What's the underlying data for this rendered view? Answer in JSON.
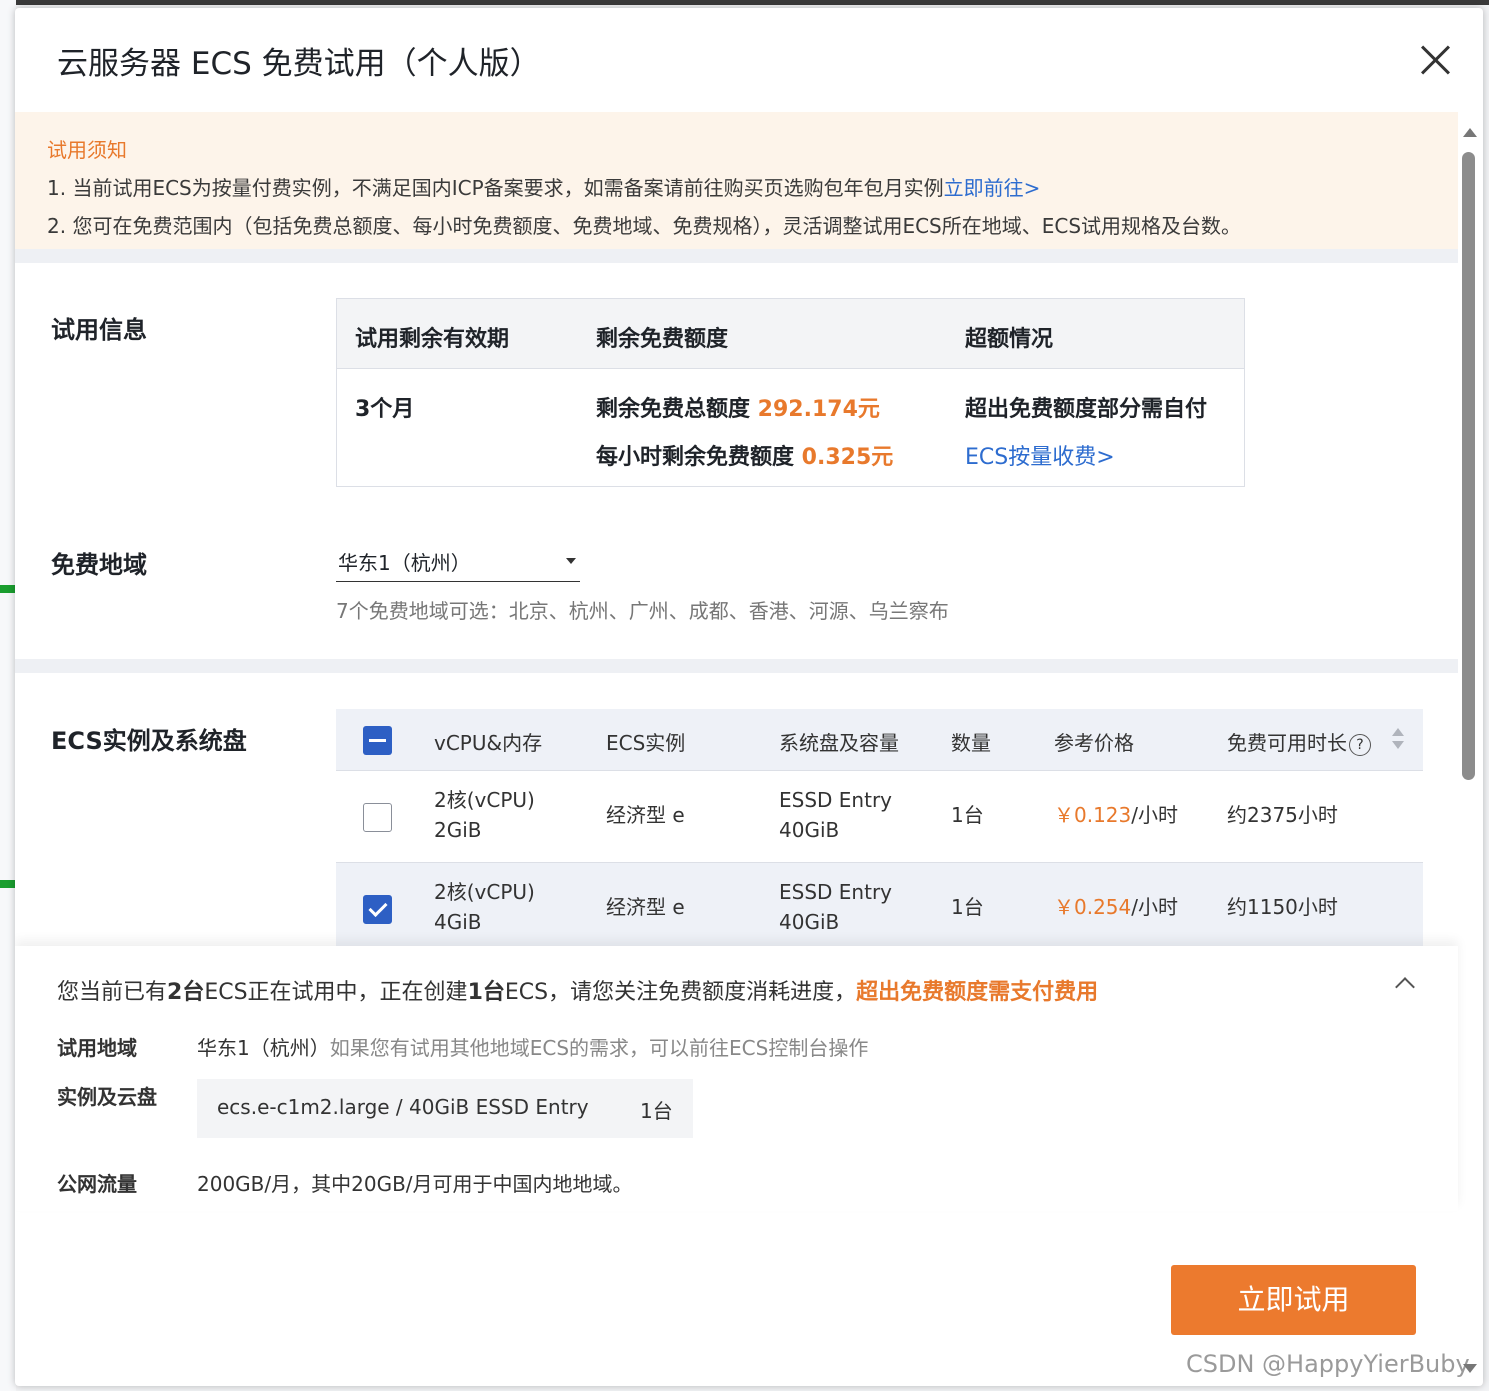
{
  "modal": {
    "title": "云服务器 ECS 免费试用（个人版）"
  },
  "notice": {
    "title": "试用须知",
    "line1_text": "1. 当前试用ECS为按量付费实例，不满足国内ICP备案要求，如需备案请前往购买页选购包年包月实例",
    "line1_link": "立即前往>",
    "line2_text": "2. 您可在免费范围内（包括免费总额度、每小时免费额度、免费地域、免费规格），灵活调整试用ECS所在地域、ECS试用规格及台数。"
  },
  "trial_info": {
    "label": "试用信息",
    "headers": [
      "试用剩余有效期",
      "剩余免费额度",
      "超额情况"
    ],
    "validity": "3个月",
    "total_quota_label": "剩余免费总额度 ",
    "total_quota_value": "292.174元",
    "hourly_quota_label": "每小时剩余免费额度 ",
    "hourly_quota_value": "0.325元",
    "overage_text": "超出免费额度部分需自付",
    "overage_link": "ECS按量收费>"
  },
  "region": {
    "label": "免费地域",
    "selected": "华东1（杭州）",
    "hint": "7个免费地域可选：北京、杭州、广州、成都、香港、河源、乌兰察布"
  },
  "ecs": {
    "label": "ECS实例及系统盘",
    "headers": {
      "vcpu": "vCPU&内存",
      "instance": "ECS实例",
      "disk": "系统盘及容量",
      "qty": "数量",
      "price": "参考价格",
      "duration": "免费可用时长"
    },
    "help_glyph": "?",
    "rows": [
      {
        "vcpu": "2核(vCPU)",
        "mem": "2GiB",
        "instance": "经济型 e",
        "disk": "ESSD Entry",
        "disk_size": "40GiB",
        "qty": "1台",
        "price": "￥0.123",
        "unit": "/小时",
        "duration": "约2375小时",
        "checked": false
      },
      {
        "vcpu": "2核(vCPU)",
        "mem": "4GiB",
        "instance": "经济型 e",
        "disk": "ESSD Entry",
        "disk_size": "40GiB",
        "qty": "1台",
        "price": "￥0.254",
        "unit": "/小时",
        "duration": "约1150小时",
        "checked": true
      }
    ]
  },
  "summary": {
    "p1": "您当前已有",
    "b1": "2台",
    "p2": "ECS正在试用中，正在创建",
    "b2": "1台",
    "p3": "ECS，请您关注免费额度消耗进度，",
    "warn": "超出免费额度需支付费用",
    "region_label": "试用地域",
    "region_value": "华东1（杭州）",
    "region_hint": "如果您有试用其他地域ECS的需求，可以前往ECS控制台操作",
    "spec_label": "实例及云盘",
    "spec_value": "ecs.e-c1m2.large / 40GiB ESSD Entry",
    "spec_qty": "1台",
    "traffic_label": "公网流量",
    "traffic_value": "200GB/月，其中20GB/月可用于中国内地地域。"
  },
  "submit_label": "立即试用",
  "watermark": "CSDN @HappyYierBuby",
  "colors": {
    "accent": "#ec7a2e",
    "link": "#2d6ccf",
    "checkbox": "#2d5fc4",
    "notice_bg": "#fdf4ea"
  }
}
